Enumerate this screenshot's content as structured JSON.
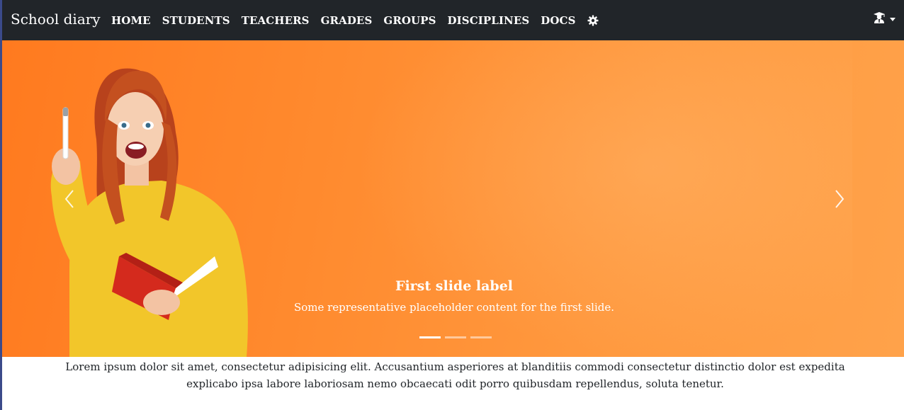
{
  "navbar": {
    "brand": "School diary",
    "links": [
      "HOME",
      "STUDENTS",
      "TEACHERS",
      "GRADES",
      "GROUPS",
      "DISCIPLINES",
      "DOCS"
    ],
    "settings_icon": "gear-icon",
    "user_icon": "graduate-user-icon"
  },
  "carousel": {
    "caption_title": "First slide label",
    "caption_text": "Some representative placeholder content for the first slide.",
    "slide_count": 3,
    "active_slide": 1,
    "prev_icon": "chevron-left-icon",
    "next_icon": "chevron-right-icon",
    "background_color": "#ff8a2e"
  },
  "intro": {
    "text": "Lorem ipsum dolor sit amet, consectetur adipisicing elit. Accusantium asperiores at blanditiis commodi consectetur distinctio dolor est expedita explicabo ipsa labore laboriosam nemo obcaecati odit porro quibusdam repellendus, soluta tenetur."
  },
  "colors": {
    "navbar_bg": "#212529",
    "text_light": "#ffffff"
  }
}
